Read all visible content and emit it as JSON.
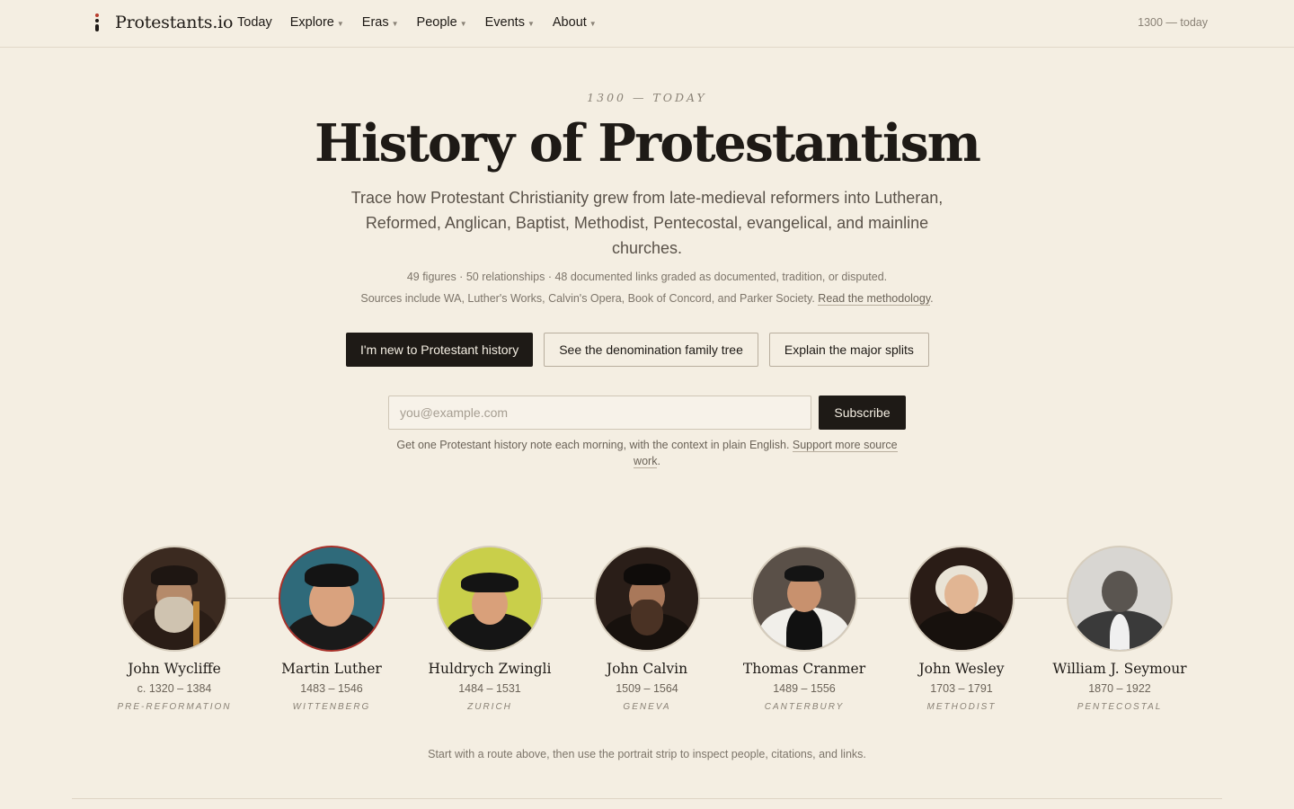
{
  "nav": {
    "brand": "Protestants.io",
    "items": [
      {
        "label": "Today",
        "caret": false
      },
      {
        "label": "Explore",
        "caret": true
      },
      {
        "label": "Eras",
        "caret": true
      },
      {
        "label": "People",
        "caret": true
      },
      {
        "label": "Events",
        "caret": true
      },
      {
        "label": "About",
        "caret": true
      }
    ],
    "range": "1300 — today"
  },
  "hero": {
    "eyebrow": "1300 — TODAY",
    "title": "History of Protestantism",
    "lede": "Trace how Protestant Christianity grew from late-medieval reformers into Lutheran, Reformed, Anglican, Baptist, Methodist, Pentecostal, evangelical, and mainline churches.",
    "stats": "49 figures · 50 relationships · 48 documented links graded as documented, tradition, or disputed.",
    "sources_text": "Sources include WA, Luther's Works, Calvin's Opera, Book of Concord, and Parker Society. ",
    "sources_link": "Read the methodology",
    "sources_end": "."
  },
  "ctas": {
    "new": "I'm new to Protestant history",
    "tree": "See the denomination family tree",
    "splits": "Explain the major splits"
  },
  "subscribe": {
    "placeholder": "you@example.com",
    "button": "Subscribe",
    "note_text": "Get one Protestant history note each morning, with the context in plain English. ",
    "note_link": "Support more source work",
    "note_end": "."
  },
  "figures": [
    {
      "name": "John Wycliffe",
      "dates": "c. 1320 – 1384",
      "place": "PRE-REFORMATION"
    },
    {
      "name": "Martin Luther",
      "dates": "1483 – 1546",
      "place": "WITTENBERG"
    },
    {
      "name": "Huldrych Zwingli",
      "dates": "1484 – 1531",
      "place": "ZURICH"
    },
    {
      "name": "John Calvin",
      "dates": "1509 – 1564",
      "place": "GENEVA"
    },
    {
      "name": "Thomas Cranmer",
      "dates": "1489 – 1556",
      "place": "CANTERBURY"
    },
    {
      "name": "John Wesley",
      "dates": "1703 – 1791",
      "place": "METHODIST"
    },
    {
      "name": "William J. Seymour",
      "dates": "1870 – 1922",
      "place": "PENTECOSTAL"
    }
  ],
  "hint": "Start with a route above, then use the portrait strip to inspect people, citations, and links.",
  "colors": {
    "background": "#f4eee2",
    "ink": "#1e1a16",
    "accent": "#a8312a"
  }
}
